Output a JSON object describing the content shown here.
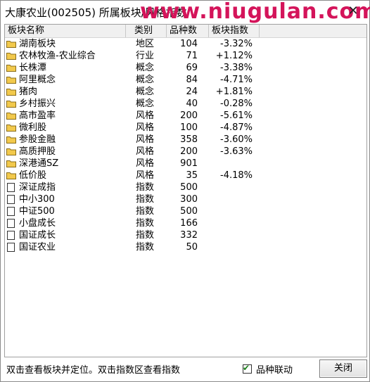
{
  "window": {
    "title": "大康农业(002505) 所属板块/风格指数",
    "watermark": "www.niugulan.com"
  },
  "columns": [
    "板块名称",
    "类别",
    "品种数",
    "板块指数"
  ],
  "rows": [
    {
      "icon": "folder-icon",
      "name": "湖南板块",
      "type": "地区",
      "count": "104",
      "index": "-3.32%"
    },
    {
      "icon": "folder-icon",
      "name": "农林牧渔-农业综合",
      "type": "行业",
      "count": "71",
      "index": "+1.12%"
    },
    {
      "icon": "folder-icon",
      "name": "长株潭",
      "type": "概念",
      "count": "69",
      "index": "-3.38%"
    },
    {
      "icon": "folder-icon",
      "name": "阿里概念",
      "type": "概念",
      "count": "84",
      "index": "-4.71%"
    },
    {
      "icon": "folder-icon",
      "name": "猪肉",
      "type": "概念",
      "count": "24",
      "index": "+1.81%"
    },
    {
      "icon": "folder-icon",
      "name": "乡村振兴",
      "type": "概念",
      "count": "40",
      "index": "-0.28%"
    },
    {
      "icon": "folder-icon",
      "name": "高市盈率",
      "type": "风格",
      "count": "200",
      "index": "-5.61%"
    },
    {
      "icon": "folder-icon",
      "name": "微利股",
      "type": "风格",
      "count": "100",
      "index": "-4.87%"
    },
    {
      "icon": "folder-icon",
      "name": "参股金融",
      "type": "风格",
      "count": "358",
      "index": "-3.60%"
    },
    {
      "icon": "folder-icon",
      "name": "高质押股",
      "type": "风格",
      "count": "200",
      "index": "-3.63%"
    },
    {
      "icon": "folder-icon",
      "name": "深港通SZ",
      "type": "风格",
      "count": "901",
      "index": ""
    },
    {
      "icon": "folder-icon",
      "name": "低价股",
      "type": "风格",
      "count": "35",
      "index": "-4.18%"
    },
    {
      "icon": "doc-icon",
      "name": "深证成指",
      "type": "指数",
      "count": "500",
      "index": ""
    },
    {
      "icon": "doc-icon",
      "name": "中小300",
      "type": "指数",
      "count": "300",
      "index": ""
    },
    {
      "icon": "doc-icon",
      "name": "中证500",
      "type": "指数",
      "count": "500",
      "index": ""
    },
    {
      "icon": "doc-icon",
      "name": "小盘成长",
      "type": "指数",
      "count": "166",
      "index": ""
    },
    {
      "icon": "doc-icon",
      "name": "国证成长",
      "type": "指数",
      "count": "332",
      "index": ""
    },
    {
      "icon": "doc-icon",
      "name": "国证农业",
      "type": "指数",
      "count": "50",
      "index": ""
    }
  ],
  "status": {
    "hint": "双击查看板块并定位。双击指数区查看指数",
    "checkbox_label": "品种联动",
    "checkbox_checked": true,
    "close_label": "关闭"
  },
  "colors": {
    "watermark": "#d4145a",
    "folder": "#f2c94c"
  }
}
